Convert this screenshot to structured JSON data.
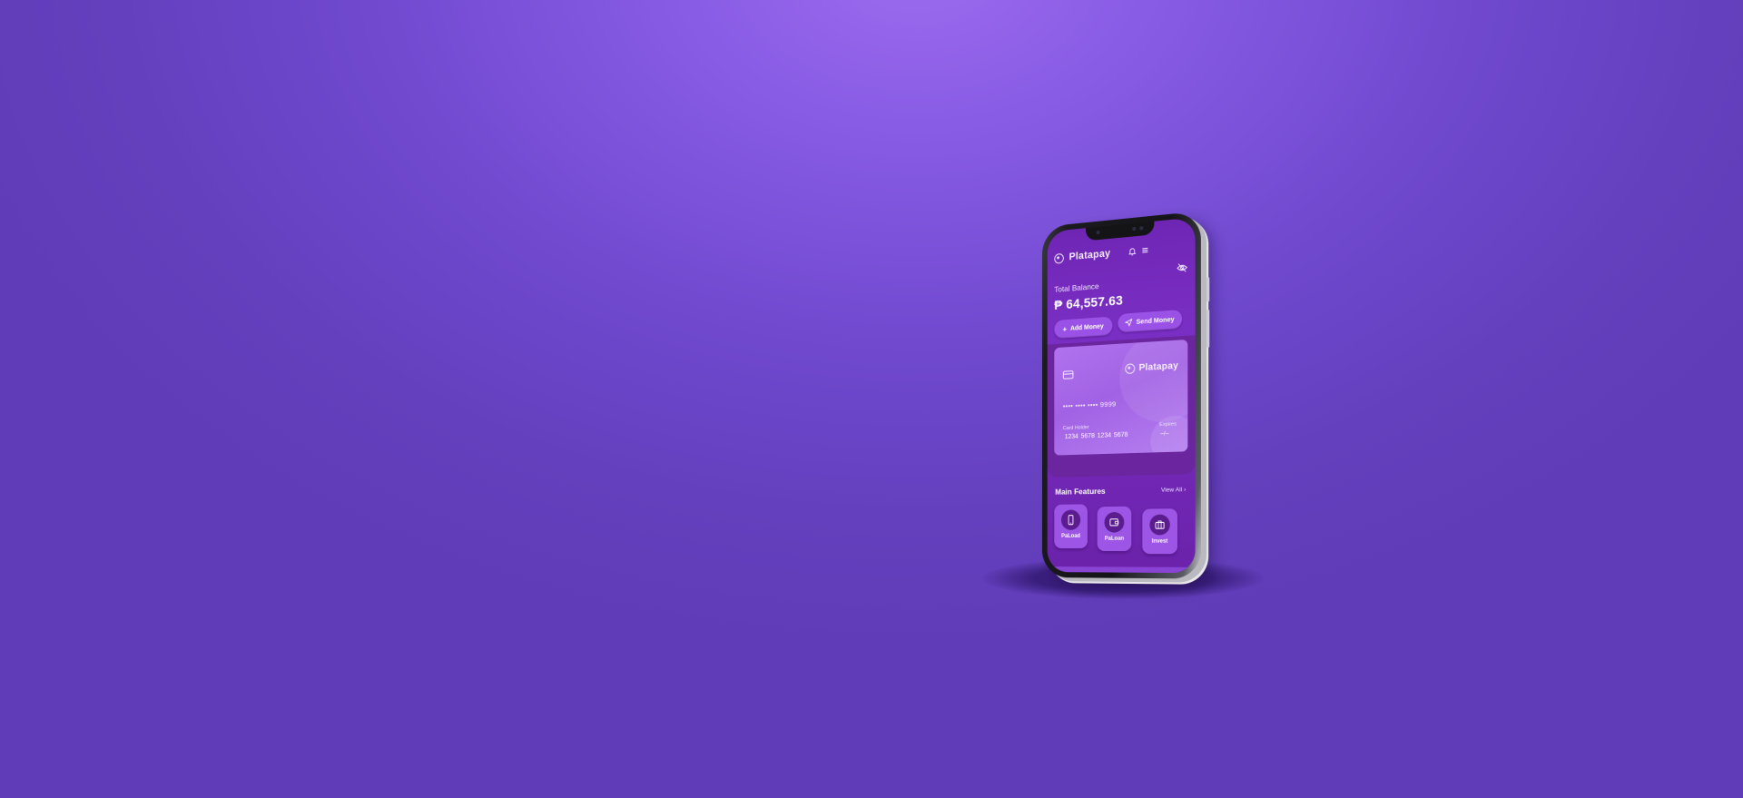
{
  "app": {
    "brand": "Platapay"
  },
  "balance": {
    "label": "Total Balance",
    "amount": "₱ 64,557.63"
  },
  "actions": {
    "add_money": "Add Money",
    "send_money": "Send Money",
    "add_icon": "plus-icon",
    "send_icon": "paper-plane-icon"
  },
  "card": {
    "brand": "Platapay",
    "number": "•••• •••• •••• 9999",
    "holder_label": "Card Holder",
    "holder_value": "1234  5678  1234  5678",
    "expires_label": "Expires",
    "expires_value": "--/--"
  },
  "features": {
    "title": "Main Features",
    "view_all": "View All ›",
    "items": [
      {
        "label": "PaLoad",
        "icon": "mobile-phone-icon"
      },
      {
        "label": "PaLoan",
        "icon": "wallet-icon"
      },
      {
        "label": "Invest",
        "icon": "briefcase-icon"
      }
    ]
  },
  "header": {
    "icons": [
      "bell-icon",
      "menu-icon"
    ]
  },
  "colors": {
    "background": "#7049cf",
    "screen": "#7a2fc4",
    "button": "#9a52e6",
    "card": "#a262e4"
  }
}
